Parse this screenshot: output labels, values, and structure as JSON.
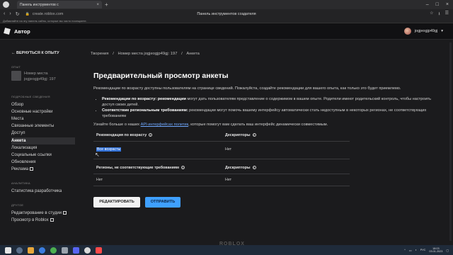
{
  "browser": {
    "tab_title": "Панель инструментов с",
    "url": "create.roblox.com",
    "page_title": "Панель инструментов создателя",
    "bookmarks_hint": "Добавляйте на эту панель сайты, которые вы часто посещаете."
  },
  "header": {
    "app_name": "Автор",
    "username": "jogjeogjp49gj"
  },
  "sidebar": {
    "back_label": "ВЕРНУТЬСЯ К ОПЫТУ",
    "section_experience": "ОПЫТ",
    "place_line1": "Номер места",
    "place_line2": "jogjeogjp49gj: 197",
    "section_basic": "ПОДРОБНЫЕ СВЕДЕНИЯ",
    "items": [
      {
        "label": "Обзор"
      },
      {
        "label": "Основные настройки"
      },
      {
        "label": "Места"
      },
      {
        "label": "Связанные элементы"
      },
      {
        "label": "Доступ"
      },
      {
        "label": "Анкета"
      },
      {
        "label": "Локализация"
      },
      {
        "label": "Социальные ссылки"
      },
      {
        "label": "Обновления"
      },
      {
        "label": "Реклама"
      }
    ],
    "section_analytics": "АНАЛИТИКА",
    "analytics_item": "Статистика разработчика",
    "section_other": "ДРУГОЕ",
    "other_items": [
      {
        "label": "Редактирование в студии"
      },
      {
        "label": "Просмотр в Roblox"
      }
    ]
  },
  "main": {
    "breadcrumb": [
      "Творения",
      "/",
      "Номер места jogjeogjp49gj: 197",
      "/",
      "Анкета"
    ],
    "title": "Предварительный просмотр анкеты",
    "intro": "Рекомендации по возрасту доступны пользователям на странице сведений. Пожалуйста, создайте рекомендации для вашего опыта, как только это будет приемлемо.",
    "bullet1_bold": "Рекомендации по возрасту: рекомендации",
    "bullet1_text": "могут дать пользователям представление о содержимом в вашем опыте. Родители имеют родительский контроль, чтобы настроить доступ своих детей.",
    "bullet2_bold": "Соответствие региональным требованиям:",
    "bullet2_text": "рекомендации могут помочь вашему интерфейсу автоматически стать недоступным в некоторых регионах, не соответствующих требованиям",
    "learn_prefix": "Узнайте больше о наших",
    "learn_link": "API-интерфейсах политик",
    "learn_suffix": ", которые помогут вам сделать ваш интерфейс динамически совместимым.",
    "table1": {
      "col1": "Рекомендация по возрасту",
      "col2": "Дескрипторы",
      "val1": "Все возрасты",
      "val2": "Нет"
    },
    "table2": {
      "col1": "Регионы, не соответствующие требованиям",
      "col2": "Дескрипторы",
      "val1": "Нет",
      "val2": "Нет"
    },
    "edit_button": "РЕДАКТИРОВАТЬ",
    "send_button": "ОТПРАВИТЬ",
    "footer_logo": "ROBLOX"
  },
  "taskbar": {
    "lang": "РУС",
    "time": "18:03",
    "date": "03.01.2023"
  },
  "colors": {
    "accent_blue": "#3fa0ff",
    "selection": "#2f6fd6",
    "link": "#6fa8ff"
  }
}
